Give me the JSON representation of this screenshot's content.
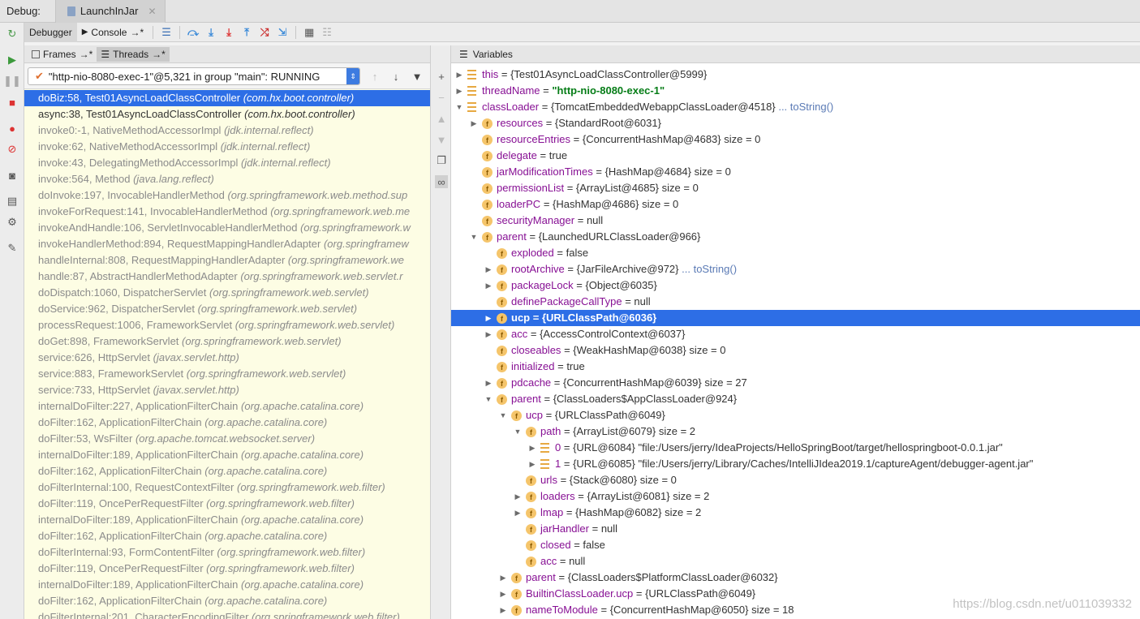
{
  "topbar": {
    "label": "Debug:",
    "tab": "LaunchInJar"
  },
  "toolbar": {
    "debugger_tab": "Debugger",
    "console_tab": "Console",
    "console_suffix": "→*"
  },
  "left_panel": {
    "frames_tab": "Frames",
    "threads_tab": "Threads",
    "tab_suffix": "→*",
    "thread": "\"http-nio-8080-exec-1\"@5,321 in group \"main\": RUNNING",
    "frames": [
      {
        "method": "doBiz:58, Test01AsyncLoadClassController",
        "pkg": "(com.hx.boot.controller)",
        "kind": "sel"
      },
      {
        "method": "async:38, Test01AsyncLoadClassController",
        "pkg": "(com.hx.boot.controller)",
        "kind": "app"
      },
      {
        "method": "invoke0:-1, NativeMethodAccessorImpl",
        "pkg": "(jdk.internal.reflect)",
        "kind": "lib"
      },
      {
        "method": "invoke:62, NativeMethodAccessorImpl",
        "pkg": "(jdk.internal.reflect)",
        "kind": "lib"
      },
      {
        "method": "invoke:43, DelegatingMethodAccessorImpl",
        "pkg": "(jdk.internal.reflect)",
        "kind": "lib"
      },
      {
        "method": "invoke:564, Method",
        "pkg": "(java.lang.reflect)",
        "kind": "lib"
      },
      {
        "method": "doInvoke:197, InvocableHandlerMethod",
        "pkg": "(org.springframework.web.method.sup",
        "kind": "lib"
      },
      {
        "method": "invokeForRequest:141, InvocableHandlerMethod",
        "pkg": "(org.springframework.web.me",
        "kind": "lib"
      },
      {
        "method": "invokeAndHandle:106, ServletInvocableHandlerMethod",
        "pkg": "(org.springframework.w",
        "kind": "lib"
      },
      {
        "method": "invokeHandlerMethod:894, RequestMappingHandlerAdapter",
        "pkg": "(org.springframew",
        "kind": "lib"
      },
      {
        "method": "handleInternal:808, RequestMappingHandlerAdapter",
        "pkg": "(org.springframework.we",
        "kind": "lib"
      },
      {
        "method": "handle:87, AbstractHandlerMethodAdapter",
        "pkg": "(org.springframework.web.servlet.r",
        "kind": "lib"
      },
      {
        "method": "doDispatch:1060, DispatcherServlet",
        "pkg": "(org.springframework.web.servlet)",
        "kind": "lib"
      },
      {
        "method": "doService:962, DispatcherServlet",
        "pkg": "(org.springframework.web.servlet)",
        "kind": "lib"
      },
      {
        "method": "processRequest:1006, FrameworkServlet",
        "pkg": "(org.springframework.web.servlet)",
        "kind": "lib"
      },
      {
        "method": "doGet:898, FrameworkServlet",
        "pkg": "(org.springframework.web.servlet)",
        "kind": "lib"
      },
      {
        "method": "service:626, HttpServlet",
        "pkg": "(javax.servlet.http)",
        "kind": "lib"
      },
      {
        "method": "service:883, FrameworkServlet",
        "pkg": "(org.springframework.web.servlet)",
        "kind": "lib"
      },
      {
        "method": "service:733, HttpServlet",
        "pkg": "(javax.servlet.http)",
        "kind": "lib"
      },
      {
        "method": "internalDoFilter:227, ApplicationFilterChain",
        "pkg": "(org.apache.catalina.core)",
        "kind": "lib"
      },
      {
        "method": "doFilter:162, ApplicationFilterChain",
        "pkg": "(org.apache.catalina.core)",
        "kind": "lib"
      },
      {
        "method": "doFilter:53, WsFilter",
        "pkg": "(org.apache.tomcat.websocket.server)",
        "kind": "lib"
      },
      {
        "method": "internalDoFilter:189, ApplicationFilterChain",
        "pkg": "(org.apache.catalina.core)",
        "kind": "lib"
      },
      {
        "method": "doFilter:162, ApplicationFilterChain",
        "pkg": "(org.apache.catalina.core)",
        "kind": "lib"
      },
      {
        "method": "doFilterInternal:100, RequestContextFilter",
        "pkg": "(org.springframework.web.filter)",
        "kind": "lib"
      },
      {
        "method": "doFilter:119, OncePerRequestFilter",
        "pkg": "(org.springframework.web.filter)",
        "kind": "lib"
      },
      {
        "method": "internalDoFilter:189, ApplicationFilterChain",
        "pkg": "(org.apache.catalina.core)",
        "kind": "lib"
      },
      {
        "method": "doFilter:162, ApplicationFilterChain",
        "pkg": "(org.apache.catalina.core)",
        "kind": "lib"
      },
      {
        "method": "doFilterInternal:93, FormContentFilter",
        "pkg": "(org.springframework.web.filter)",
        "kind": "lib"
      },
      {
        "method": "doFilter:119, OncePerRequestFilter",
        "pkg": "(org.springframework.web.filter)",
        "kind": "lib"
      },
      {
        "method": "internalDoFilter:189, ApplicationFilterChain",
        "pkg": "(org.apache.catalina.core)",
        "kind": "lib"
      },
      {
        "method": "doFilter:162, ApplicationFilterChain",
        "pkg": "(org.apache.catalina.core)",
        "kind": "lib"
      },
      {
        "method": "doFilterInternal:201, CharacterEncodingFilter",
        "pkg": "(org.springframework.web.filter)",
        "kind": "lib"
      }
    ]
  },
  "variables": {
    "title": "Variables",
    "rows": [
      {
        "depth": 0,
        "arrow": "right",
        "icon": "static",
        "name": "this",
        "value": "= {Test01AsyncLoadClassController@5999}"
      },
      {
        "depth": 0,
        "arrow": "right",
        "icon": "static",
        "name": "threadName",
        "value": "= ",
        "str": "\"http-nio-8080-exec-1\""
      },
      {
        "depth": 0,
        "arrow": "down",
        "icon": "static",
        "name": "classLoader",
        "value": "= {TomcatEmbeddedWebappClassLoader@4518}",
        "link": "... toString()"
      },
      {
        "depth": 1,
        "arrow": "right",
        "icon": "f",
        "name": "resources",
        "value": "= {StandardRoot@6031}"
      },
      {
        "depth": 1,
        "arrow": "",
        "icon": "f",
        "name": "resourceEntries",
        "value": "= {ConcurrentHashMap@4683}",
        "size": "size = 0"
      },
      {
        "depth": 1,
        "arrow": "",
        "icon": "f",
        "name": "delegate",
        "value": "= true"
      },
      {
        "depth": 1,
        "arrow": "",
        "icon": "f",
        "name": "jarModificationTimes",
        "value": "= {HashMap@4684}",
        "size": "size = 0"
      },
      {
        "depth": 1,
        "arrow": "",
        "icon": "f",
        "name": "permissionList",
        "value": "= {ArrayList@4685}",
        "size": "size = 0"
      },
      {
        "depth": 1,
        "arrow": "",
        "icon": "f",
        "name": "loaderPC",
        "value": "= {HashMap@4686}",
        "size": "size = 0"
      },
      {
        "depth": 1,
        "arrow": "",
        "icon": "f",
        "name": "securityManager",
        "value": "= null"
      },
      {
        "depth": 1,
        "arrow": "down",
        "icon": "f",
        "name": "parent",
        "value": "= {LaunchedURLClassLoader@966}"
      },
      {
        "depth": 2,
        "arrow": "",
        "icon": "f",
        "name": "exploded",
        "value": "= false"
      },
      {
        "depth": 2,
        "arrow": "right",
        "icon": "f",
        "name": "rootArchive",
        "value": "= {JarFileArchive@972}",
        "link": "... toString()"
      },
      {
        "depth": 2,
        "arrow": "right",
        "icon": "f",
        "name": "packageLock",
        "value": "= {Object@6035}"
      },
      {
        "depth": 2,
        "arrow": "",
        "icon": "f",
        "name": "definePackageCallType",
        "value": "= null"
      },
      {
        "depth": 2,
        "arrow": "right",
        "icon": "f",
        "name": "ucp",
        "value": "= {URLClassPath@6036}",
        "sel": true
      },
      {
        "depth": 2,
        "arrow": "right",
        "icon": "f",
        "name": "acc",
        "value": "= {AccessControlContext@6037}"
      },
      {
        "depth": 2,
        "arrow": "",
        "icon": "f",
        "name": "closeables",
        "value": "= {WeakHashMap@6038}",
        "size": "size = 0"
      },
      {
        "depth": 2,
        "arrow": "",
        "icon": "f",
        "name": "initialized",
        "value": "= true"
      },
      {
        "depth": 2,
        "arrow": "right",
        "icon": "f",
        "name": "pdcache",
        "value": "= {ConcurrentHashMap@6039}",
        "size": "size = 27"
      },
      {
        "depth": 2,
        "arrow": "down",
        "icon": "f",
        "name": "parent",
        "value": "= {ClassLoaders$AppClassLoader@924}"
      },
      {
        "depth": 3,
        "arrow": "down",
        "icon": "f",
        "name": "ucp",
        "value": "= {URLClassPath@6049}"
      },
      {
        "depth": 4,
        "arrow": "down",
        "icon": "f",
        "name": "path",
        "value": "= {ArrayList@6079}",
        "size": "size = 2"
      },
      {
        "depth": 5,
        "arrow": "right",
        "icon": "list",
        "name": "0",
        "value": "= {URL@6084} \"file:/Users/jerry/IdeaProjects/HelloSpringBoot/target/hellospringboot-0.0.1.jar\""
      },
      {
        "depth": 5,
        "arrow": "right",
        "icon": "list",
        "name": "1",
        "value": "= {URL@6085} \"file:/Users/jerry/Library/Caches/IntelliJIdea2019.1/captureAgent/debugger-agent.jar\""
      },
      {
        "depth": 4,
        "arrow": "",
        "icon": "f",
        "name": "urls",
        "value": "= {Stack@6080}",
        "size": "size = 0"
      },
      {
        "depth": 4,
        "arrow": "right",
        "icon": "f",
        "name": "loaders",
        "value": "= {ArrayList@6081}",
        "size": "size = 2"
      },
      {
        "depth": 4,
        "arrow": "right",
        "icon": "f",
        "name": "lmap",
        "value": "= {HashMap@6082}",
        "size": "size = 2"
      },
      {
        "depth": 4,
        "arrow": "",
        "icon": "f",
        "name": "jarHandler",
        "value": "= null"
      },
      {
        "depth": 4,
        "arrow": "",
        "icon": "f",
        "name": "closed",
        "value": "= false"
      },
      {
        "depth": 4,
        "arrow": "",
        "icon": "f",
        "name": "acc",
        "value": "= null"
      },
      {
        "depth": 3,
        "arrow": "right",
        "icon": "f",
        "name": "parent",
        "value": "= {ClassLoaders$PlatformClassLoader@6032}"
      },
      {
        "depth": 3,
        "arrow": "right",
        "icon": "f",
        "name": "BuiltinClassLoader.ucp",
        "value": "= {URLClassPath@6049}"
      },
      {
        "depth": 3,
        "arrow": "right",
        "icon": "f",
        "name": "nameToModule",
        "value": "= {ConcurrentHashMap@6050}",
        "size": "size = 18"
      }
    ]
  },
  "watermark": "https://blog.csdn.net/u011039332"
}
